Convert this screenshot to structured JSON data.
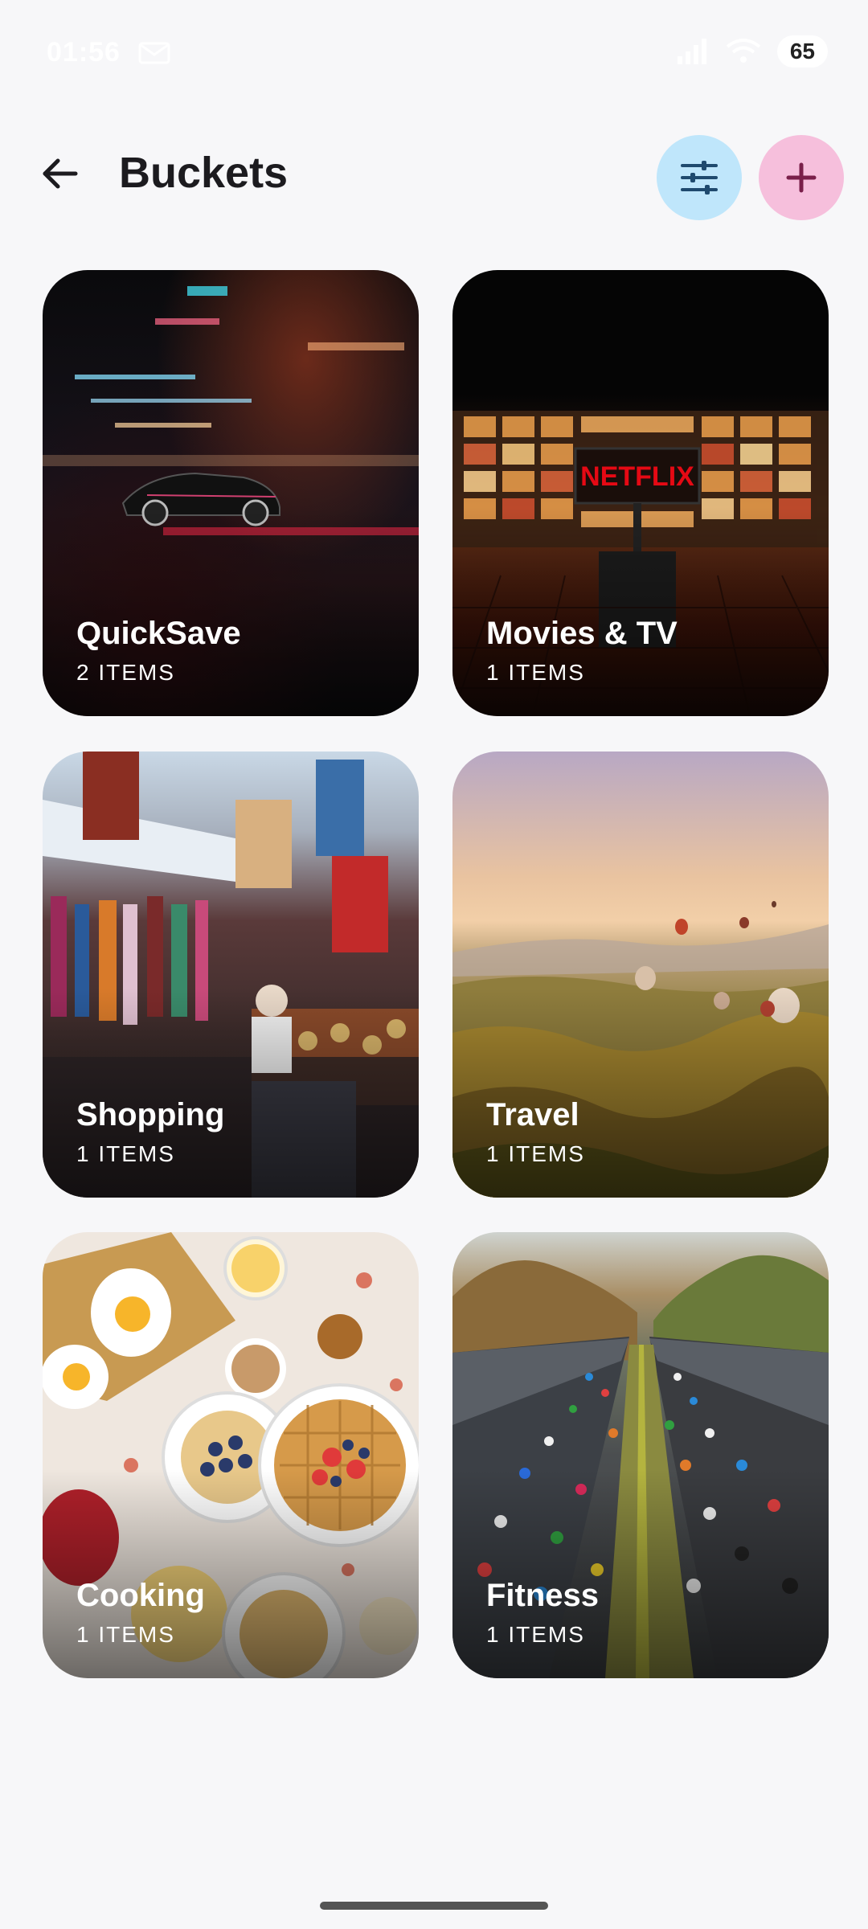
{
  "status_bar": {
    "time": "01:56",
    "battery": "65"
  },
  "header": {
    "title": "Buckets"
  },
  "buckets": [
    {
      "name": "QuickSave",
      "count": "2 ITEMS"
    },
    {
      "name": "Movies & TV",
      "count": "1 ITEMS",
      "image_text": "NETFLIX"
    },
    {
      "name": "Shopping",
      "count": "1 ITEMS"
    },
    {
      "name": "Travel",
      "count": "1 ITEMS"
    },
    {
      "name": "Cooking",
      "count": "1 ITEMS"
    },
    {
      "name": "Fitness",
      "count": "1 ITEMS"
    }
  ],
  "colors": {
    "filter_button_bg": "#bfe6fb",
    "add_button_bg": "#f6bfdc",
    "icon_dark_blue": "#1f4a6e",
    "icon_plum": "#7a1f4a"
  },
  "icons": [
    "back-arrow-icon",
    "tune-icon",
    "plus-icon"
  ]
}
